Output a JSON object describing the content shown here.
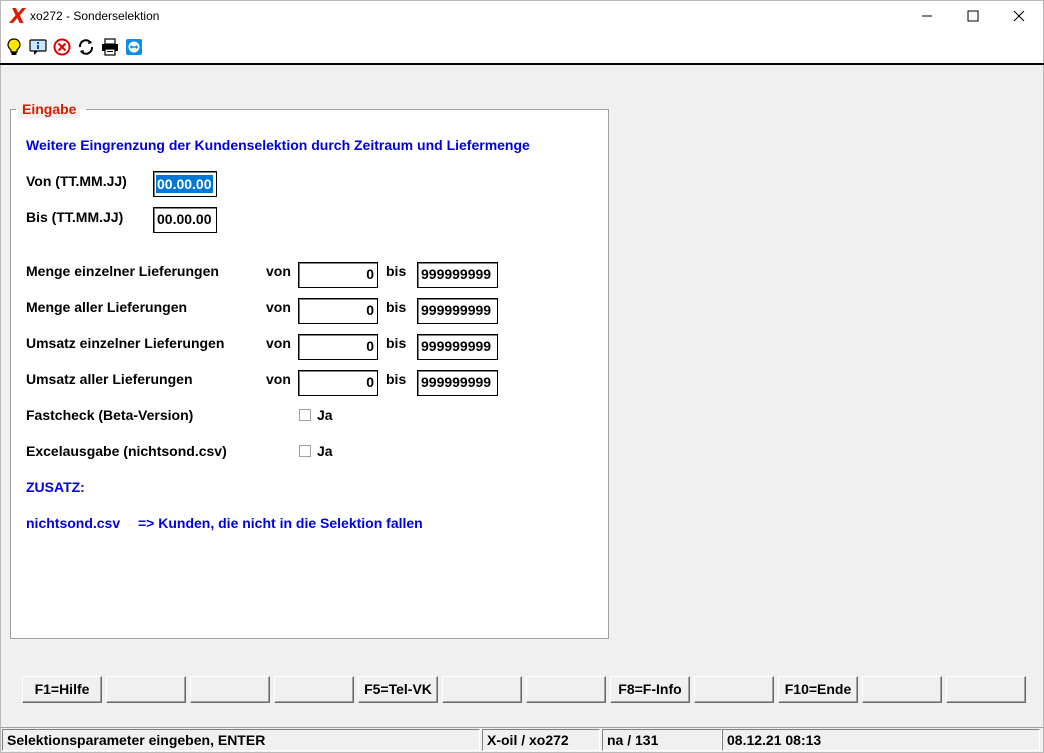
{
  "window": {
    "title": "xo272 - Sonderselektion",
    "logo_letter": "X",
    "controls": {
      "minimize": "—",
      "maximize": "☐",
      "close": "✕"
    }
  },
  "toolbar": {
    "icons": [
      "lightbulb-icon",
      "info-icon",
      "cancel-icon",
      "refresh-icon",
      "printer-icon",
      "teamviewer-icon"
    ]
  },
  "group": {
    "title": "Eingabe",
    "heading": "Weitere Eingrenzung der Kundenselektion durch Zeitraum und Liefermenge",
    "von_label": "Von (TT.MM.JJ)",
    "von_value": "00.00.00",
    "bis_label": "Bis (TT.MM.JJ)",
    "bis_value": "00.00.00",
    "range_rows": [
      {
        "label": "Menge einzelner Lieferungen",
        "von_label": "von",
        "from": "0",
        "bis_label": "bis",
        "to": "999999999"
      },
      {
        "label": "Menge aller Lieferungen",
        "von_label": "von",
        "from": "0",
        "bis_label": "bis",
        "to": "999999999"
      },
      {
        "label": "Umsatz einzelner Lieferungen",
        "von_label": "von",
        "from": "0",
        "bis_label": "bis",
        "to": "999999999"
      },
      {
        "label": "Umsatz aller Lieferungen",
        "von_label": "von",
        "from": "0",
        "bis_label": "bis",
        "to": "999999999"
      }
    ],
    "fastcheck": {
      "label": "Fastcheck (Beta-Version)",
      "option": "Ja",
      "checked": false
    },
    "excel": {
      "label": "Excelausgabe (nichtsond.csv)",
      "option": "Ja",
      "checked": false
    },
    "zusatz_label": "ZUSATZ:",
    "zusatz_file": "nichtsond.csv",
    "zusatz_text": "=> Kunden, die nicht in die Selektion fallen"
  },
  "fkeys": [
    "F1=Hilfe",
    "",
    "",
    "",
    "F5=Tel-VK",
    "",
    "",
    "F8=F-Info",
    "",
    "F10=Ende",
    "",
    ""
  ],
  "status": {
    "message": "Selektionsparameter eingeben, ENTER",
    "app": "X-oil / xo272",
    "user": "na / 131",
    "datetime": "08.12.21 08:13"
  },
  "colors": {
    "label_blue": "#0000e0",
    "group_title": "#cc2200",
    "selection": "#0078d7"
  }
}
